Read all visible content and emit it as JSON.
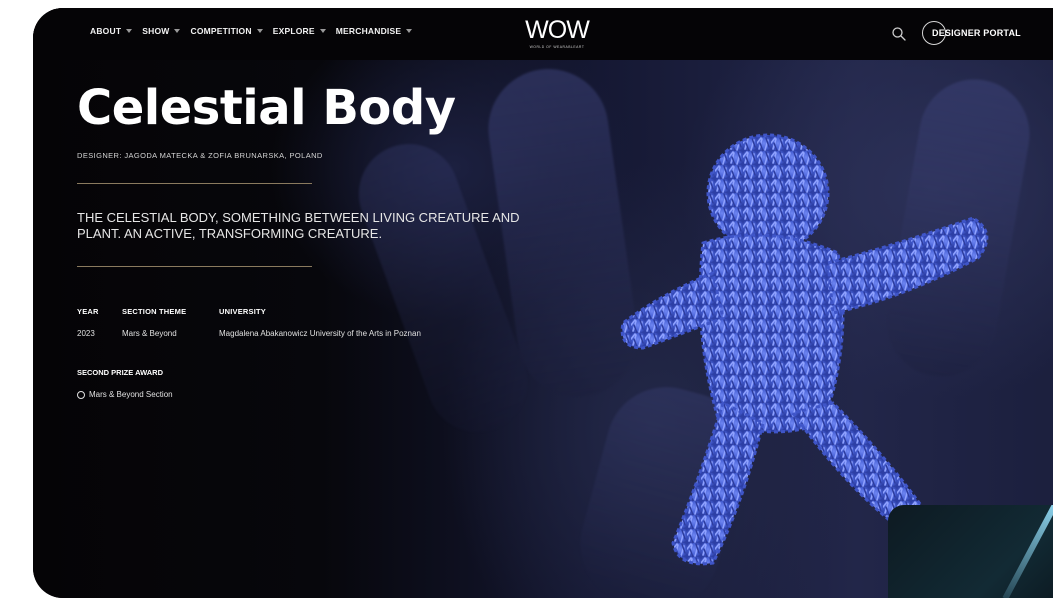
{
  "nav": {
    "items": [
      {
        "label": "ABOUT"
      },
      {
        "label": "SHOW"
      },
      {
        "label": "COMPETITION"
      },
      {
        "label": "EXPLORE"
      },
      {
        "label": "MERCHANDISE"
      }
    ],
    "logo_text": "WOW",
    "logo_subtext": "WORLD OF WEARABLEART",
    "search_icon": "search-icon",
    "portal_label": "DESIGNER PORTAL"
  },
  "garment": {
    "title": "Celestial Body",
    "designer": "DESIGNER: JAGODA MATECKA & ZOFIA BRUNARSKA, POLAND",
    "tagline": "THE CELESTIAL BODY, SOMETHING BETWEEN LIVING CREATURE AND PLANT. AN ACTIVE, TRANSFORMING CREATURE.",
    "meta": {
      "year_label": "YEAR",
      "year": "2023",
      "theme_label": "SECTION THEME",
      "theme": "Mars & Beyond",
      "university_label": "UNIVERSITY",
      "university": "Magdalena Abakanowicz University of the Arts in Poznan"
    },
    "award": {
      "label": "SECOND PRIZE AWARD",
      "item": "Mars & Beyond Section"
    }
  },
  "colors": {
    "background": "#050406",
    "accent_rule": "#8a7a5e",
    "creature_blue": "#4a63d8"
  }
}
